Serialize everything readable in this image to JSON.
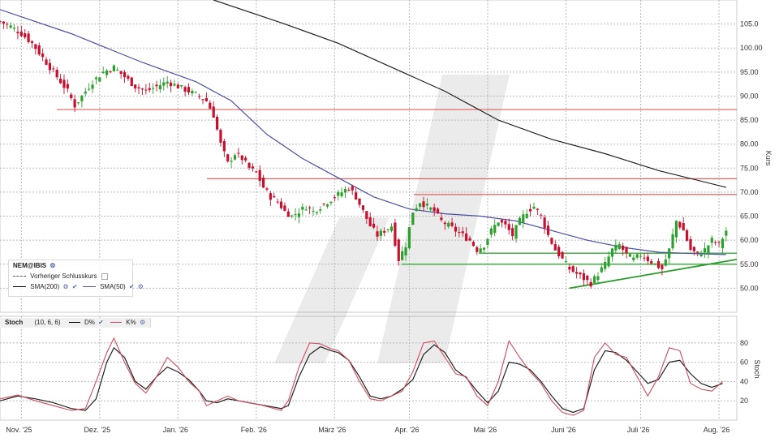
{
  "chart_data": [
    {
      "type": "candlestick",
      "instrument": "NEM@IBIS",
      "ylabel": "Kurs",
      "ylim": [
        45,
        110
      ],
      "y_ticks": [
        "50.00",
        "55.00",
        "60.00",
        "65.00",
        "70.00",
        "75.00",
        "80.00",
        "85.00",
        "90.00",
        "95.00",
        "100.00",
        "105.0"
      ],
      "x_ticks": [
        "Nov. '25",
        "Dez. '25",
        "Jan. '26",
        "Feb. '26",
        "März '26",
        "Apr. '26",
        "Mai '26",
        "Juni '26",
        "Juli '26",
        "Aug. '26"
      ],
      "grid": true,
      "legend": [
        {
          "label": "Vorheriger Schlusskurs",
          "style": "dashed"
        },
        {
          "label": "SMA(200)",
          "color": "#222222"
        },
        {
          "label": "SMA(50)",
          "color": "#4b4fa6"
        }
      ],
      "colors": {
        "up": "#2ca02c",
        "down": "#c8102e",
        "sma200": "#222222",
        "sma50": "#4b4fa6",
        "resistance": "#e06060",
        "support": "#33aa33"
      },
      "close_path": [
        [
          0,
          105.5
        ],
        [
          3,
          104.5
        ],
        [
          6,
          103
        ],
        [
          9,
          101
        ],
        [
          12,
          98
        ],
        [
          15,
          95
        ],
        [
          17,
          93
        ],
        [
          19,
          91
        ],
        [
          21,
          88
        ],
        [
          23,
          90
        ],
        [
          26,
          93
        ],
        [
          29,
          95
        ],
        [
          32,
          96
        ],
        [
          35,
          94
        ],
        [
          38,
          92
        ],
        [
          41,
          91
        ],
        [
          44,
          92
        ],
        [
          47,
          93
        ],
        [
          50,
          92
        ],
        [
          53,
          91
        ],
        [
          56,
          90
        ],
        [
          58,
          89
        ],
        [
          60,
          86
        ],
        [
          62,
          80
        ],
        [
          64,
          76
        ],
        [
          66,
          78
        ],
        [
          68,
          77
        ],
        [
          70,
          75
        ],
        [
          72,
          74
        ],
        [
          74,
          71
        ],
        [
          76,
          69
        ],
        [
          78,
          68
        ],
        [
          80,
          66
        ],
        [
          82,
          65
        ],
        [
          84,
          66
        ],
        [
          86,
          67
        ],
        [
          88,
          66
        ],
        [
          90,
          67
        ],
        [
          92,
          68
        ],
        [
          94,
          69
        ],
        [
          96,
          70
        ],
        [
          98,
          71
        ],
        [
          100,
          69
        ],
        [
          102,
          66
        ],
        [
          104,
          63
        ],
        [
          106,
          61
        ],
        [
          108,
          62
        ],
        [
          110,
          63
        ],
        [
          112,
          56
        ],
        [
          114,
          59
        ],
        [
          116,
          66
        ],
        [
          118,
          68
        ],
        [
          120,
          67
        ],
        [
          122,
          66
        ],
        [
          124,
          64
        ],
        [
          126,
          63
        ],
        [
          128,
          62
        ],
        [
          130,
          61
        ],
        [
          132,
          60
        ],
        [
          134,
          58
        ],
        [
          136,
          59
        ],
        [
          138,
          62
        ],
        [
          140,
          64
        ],
        [
          142,
          63
        ],
        [
          144,
          61
        ],
        [
          146,
          64
        ],
        [
          148,
          66
        ],
        [
          150,
          67
        ],
        [
          152,
          65
        ],
        [
          154,
          61
        ],
        [
          156,
          58
        ],
        [
          158,
          56
        ],
        [
          160,
          54
        ],
        [
          162,
          53
        ],
        [
          164,
          52
        ],
        [
          166,
          51
        ],
        [
          168,
          53
        ],
        [
          170,
          55
        ],
        [
          172,
          58
        ],
        [
          174,
          59
        ],
        [
          176,
          57
        ],
        [
          178,
          56
        ],
        [
          180,
          57
        ],
        [
          182,
          56
        ],
        [
          184,
          55
        ],
        [
          186,
          54
        ],
        [
          188,
          58
        ],
        [
          190,
          64
        ],
        [
          192,
          62
        ],
        [
          194,
          58
        ],
        [
          196,
          57
        ],
        [
          198,
          58
        ],
        [
          200,
          60
        ],
        [
          202,
          59
        ],
        [
          204,
          62
        ]
      ],
      "sma50": [
        [
          0,
          108
        ],
        [
          20,
          103
        ],
        [
          40,
          97
        ],
        [
          55,
          93
        ],
        [
          65,
          89
        ],
        [
          75,
          82
        ],
        [
          85,
          77
        ],
        [
          95,
          73
        ],
        [
          105,
          69
        ],
        [
          115,
          66.5
        ],
        [
          125,
          65.5
        ],
        [
          135,
          65
        ],
        [
          145,
          64
        ],
        [
          155,
          62
        ],
        [
          165,
          60
        ],
        [
          175,
          58.5
        ],
        [
          185,
          57.5
        ],
        [
          195,
          57.2
        ],
        [
          204,
          57
        ]
      ],
      "sma200": [
        [
          60,
          110
        ],
        [
          80,
          105
        ],
        [
          95,
          101
        ],
        [
          110,
          96
        ],
        [
          125,
          91
        ],
        [
          140,
          85
        ],
        [
          155,
          81
        ],
        [
          170,
          78
        ],
        [
          185,
          74.5
        ],
        [
          204,
          71
        ]
      ],
      "resistance_lines": [
        [
          87.2
        ],
        [
          72.8
        ],
        [
          69.5
        ]
      ],
      "support_lines": [
        [
          57.3
        ],
        [
          55
        ]
      ],
      "trendline": [
        [
          160,
          50
        ],
        [
          207,
          56
        ]
      ]
    },
    {
      "type": "line",
      "title": "Stoch",
      "params": "(10, 6, 6)",
      "ylabel": "Stoch",
      "ylim": [
        0,
        95
      ],
      "y_ticks": [
        "20",
        "40",
        "60",
        "80"
      ],
      "series": [
        {
          "name": "D%",
          "color": "#222222"
        },
        {
          "name": "K%",
          "color": "#d04b5c"
        }
      ],
      "k": [
        [
          0,
          22
        ],
        [
          5,
          26
        ],
        [
          10,
          20
        ],
        [
          15,
          15
        ],
        [
          20,
          10
        ],
        [
          24,
          12
        ],
        [
          27,
          40
        ],
        [
          30,
          70
        ],
        [
          32,
          85
        ],
        [
          35,
          60
        ],
        [
          38,
          38
        ],
        [
          41,
          28
        ],
        [
          44,
          45
        ],
        [
          47,
          65
        ],
        [
          50,
          55
        ],
        [
          53,
          40
        ],
        [
          56,
          30
        ],
        [
          58,
          15
        ],
        [
          61,
          20
        ],
        [
          64,
          25
        ],
        [
          67,
          20
        ],
        [
          70,
          18
        ],
        [
          73,
          16
        ],
        [
          76,
          13
        ],
        [
          79,
          10
        ],
        [
          81,
          20
        ],
        [
          84,
          55
        ],
        [
          87,
          80
        ],
        [
          90,
          79
        ],
        [
          93,
          74
        ],
        [
          95,
          72
        ],
        [
          98,
          62
        ],
        [
          101,
          40
        ],
        [
          104,
          22
        ],
        [
          107,
          20
        ],
        [
          110,
          25
        ],
        [
          113,
          30
        ],
        [
          116,
          50
        ],
        [
          119,
          80
        ],
        [
          122,
          82
        ],
        [
          125,
          65
        ],
        [
          128,
          48
        ],
        [
          131,
          45
        ],
        [
          134,
          25
        ],
        [
          137,
          15
        ],
        [
          140,
          40
        ],
        [
          143,
          82
        ],
        [
          146,
          65
        ],
        [
          149,
          50
        ],
        [
          152,
          38
        ],
        [
          155,
          20
        ],
        [
          158,
          8
        ],
        [
          161,
          5
        ],
        [
          164,
          10
        ],
        [
          167,
          65
        ],
        [
          170,
          80
        ],
        [
          173,
          68
        ],
        [
          176,
          65
        ],
        [
          179,
          45
        ],
        [
          182,
          25
        ],
        [
          185,
          45
        ],
        [
          188,
          75
        ],
        [
          191,
          72
        ],
        [
          194,
          38
        ],
        [
          197,
          32
        ],
        [
          200,
          30
        ],
        [
          203,
          40
        ]
      ],
      "d": [
        [
          0,
          20
        ],
        [
          5,
          25
        ],
        [
          10,
          22
        ],
        [
          15,
          18
        ],
        [
          20,
          12
        ],
        [
          24,
          10
        ],
        [
          27,
          22
        ],
        [
          30,
          60
        ],
        [
          32,
          75
        ],
        [
          35,
          65
        ],
        [
          38,
          40
        ],
        [
          41,
          32
        ],
        [
          44,
          45
        ],
        [
          47,
          55
        ],
        [
          50,
          50
        ],
        [
          53,
          42
        ],
        [
          56,
          30
        ],
        [
          58,
          20
        ],
        [
          61,
          18
        ],
        [
          64,
          22
        ],
        [
          67,
          20
        ],
        [
          70,
          18
        ],
        [
          73,
          16
        ],
        [
          76,
          14
        ],
        [
          79,
          12
        ],
        [
          81,
          15
        ],
        [
          84,
          45
        ],
        [
          87,
          68
        ],
        [
          90,
          76
        ],
        [
          93,
          72
        ],
        [
          95,
          70
        ],
        [
          98,
          62
        ],
        [
          101,
          45
        ],
        [
          104,
          25
        ],
        [
          107,
          22
        ],
        [
          110,
          25
        ],
        [
          113,
          32
        ],
        [
          116,
          42
        ],
        [
          119,
          68
        ],
        [
          122,
          78
        ],
        [
          125,
          70
        ],
        [
          128,
          52
        ],
        [
          131,
          44
        ],
        [
          134,
          30
        ],
        [
          137,
          18
        ],
        [
          140,
          30
        ],
        [
          143,
          60
        ],
        [
          146,
          58
        ],
        [
          149,
          52
        ],
        [
          152,
          40
        ],
        [
          155,
          25
        ],
        [
          158,
          12
        ],
        [
          161,
          8
        ],
        [
          164,
          12
        ],
        [
          167,
          52
        ],
        [
          170,
          72
        ],
        [
          173,
          70
        ],
        [
          176,
          62
        ],
        [
          179,
          50
        ],
        [
          182,
          38
        ],
        [
          185,
          42
        ],
        [
          188,
          60
        ],
        [
          191,
          62
        ],
        [
          194,
          48
        ],
        [
          197,
          38
        ],
        [
          200,
          34
        ],
        [
          203,
          38
        ]
      ]
    }
  ],
  "legend_box": {
    "title": "NEM@IBIS",
    "prev_close": "Vorheriger Schlusskurs",
    "sma200": "SMA(200)",
    "sma50": "SMA(50)"
  },
  "stoch_header": {
    "title": "Stoch",
    "params": "(10, 6, 6)",
    "d": "D%",
    "k": "K%"
  }
}
